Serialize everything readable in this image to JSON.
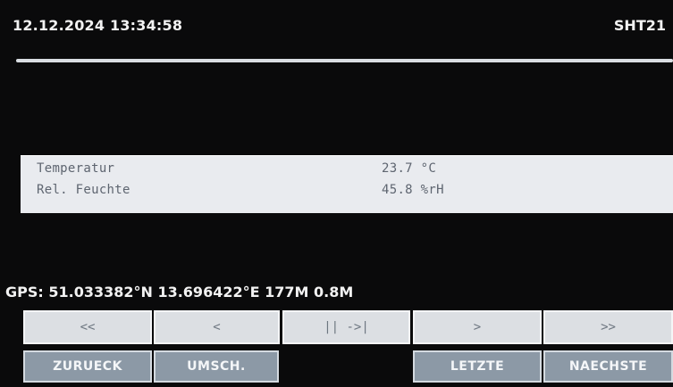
{
  "header": {
    "datetime": "12.12.2024 13:34:58",
    "sensor": "SHT21"
  },
  "readings": [
    {
      "label": "Temperatur",
      "value": "23.7 °C"
    },
    {
      "label": "Rel. Feuchte",
      "value": "45.8 %rH"
    }
  ],
  "gps": {
    "text": "GPS: 51.033382°N  13.696422°E   177M  0.8M"
  },
  "nav_buttons": [
    "<<",
    "<",
    "|| ->|",
    ">",
    ">>"
  ],
  "function_buttons": {
    "back": "ZURUECK",
    "switch": "UMSCH.",
    "last": "LETZTE",
    "next": "NAECHSTE"
  },
  "colors": {
    "screen_background": "#0a0a0b",
    "readings_panel": "#e9ebef",
    "text_dim": "#5e6570",
    "button_face": "#dcdfe3",
    "function_button": "#8c99a6"
  }
}
